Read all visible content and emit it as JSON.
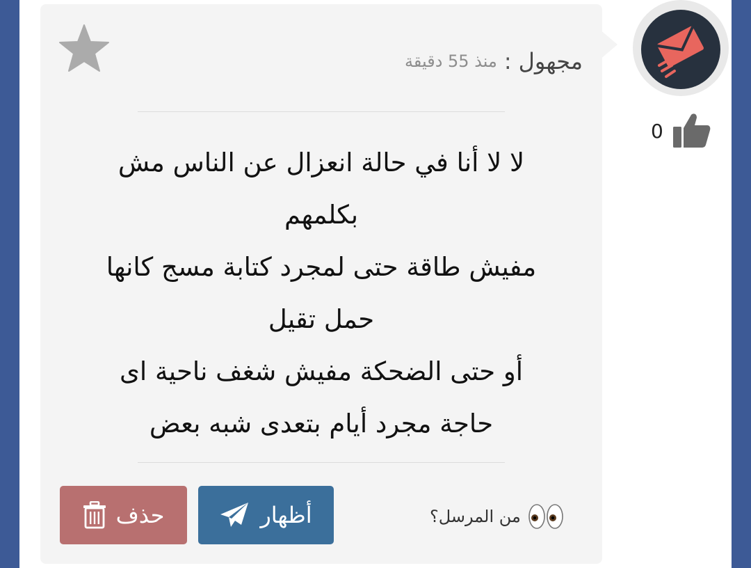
{
  "message": {
    "sender_name": "مجهول",
    "separator": ":",
    "time_ago": "منذ 55 دقيقة",
    "body_lines": [
      "لا لا أنا في حالة انعزال عن الناس مش",
      "بكلمهم",
      "مفيش طاقة حتى لمجرد كتابة مسج كانها",
      "حمل تقيل",
      "أو حتى الضحكة مفيش شغف ناحية اى",
      "حاجة مجرد أيام بتعدى شبه بعض"
    ]
  },
  "actions": {
    "show_label": "أظهار",
    "delete_label": "حذف",
    "who_sent_label": "من المرسل؟"
  },
  "likes": {
    "count": "0"
  },
  "icons": {
    "favorite": "star-icon",
    "show": "paper-plane-icon",
    "delete": "trash-icon",
    "who_sent": "eyes-icon",
    "like": "thumbs-up-icon",
    "avatar": "envelope-logo"
  },
  "colors": {
    "background": "#3d5a96",
    "card": "#f4f4f4",
    "show_button": "#3b6f9b",
    "delete_button": "#b87070",
    "avatar_bg": "#27313e",
    "avatar_logo": "#e8665e"
  }
}
